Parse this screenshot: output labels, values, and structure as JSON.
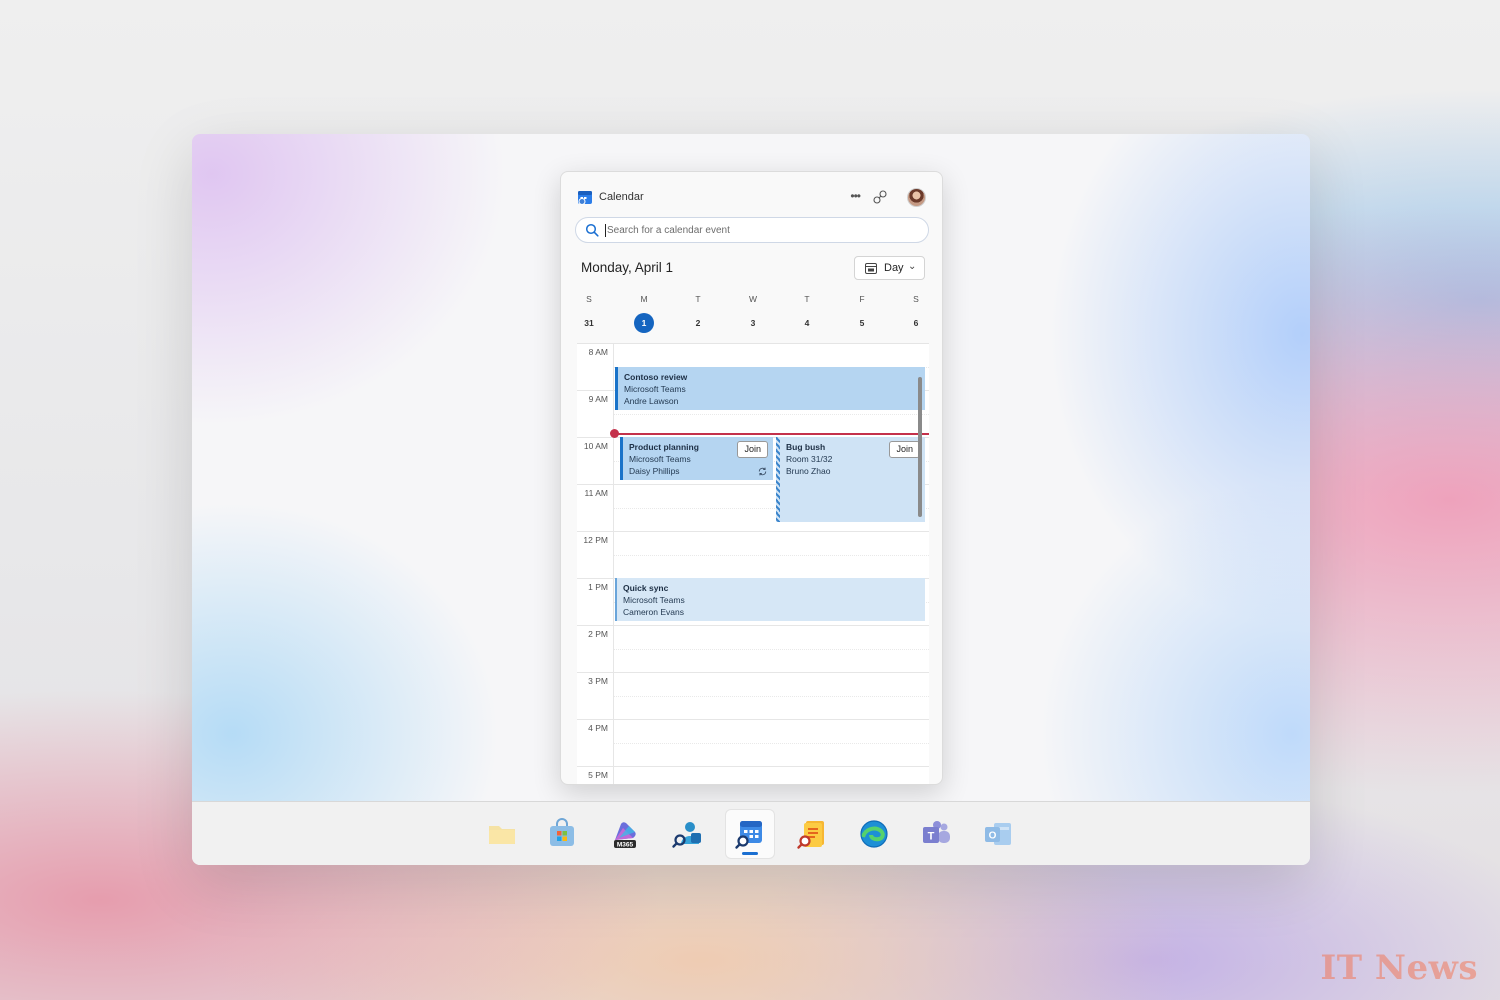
{
  "calendar": {
    "app_title": "Calendar",
    "search_placeholder": "Search for a calendar event",
    "date_title": "Monday, April 1",
    "view_label": "Day",
    "week": [
      {
        "letter": "S",
        "num": "31"
      },
      {
        "letter": "M",
        "num": "1",
        "selected": true
      },
      {
        "letter": "T",
        "num": "2"
      },
      {
        "letter": "W",
        "num": "3"
      },
      {
        "letter": "T",
        "num": "4"
      },
      {
        "letter": "F",
        "num": "5"
      },
      {
        "letter": "S",
        "num": "6"
      }
    ],
    "hours": [
      "8 AM",
      "9 AM",
      "10 AM",
      "11 AM",
      "12 PM",
      "1 PM",
      "2 PM",
      "3 PM",
      "4 PM",
      "5 PM"
    ],
    "events": {
      "contoso": {
        "title": "Contoso review",
        "location": "Microsoft Teams",
        "organizer": "Andre Lawson"
      },
      "product": {
        "title": "Product planning",
        "location": "Microsoft Teams",
        "organizer": "Daisy Phillips",
        "join_label": "Join"
      },
      "bug": {
        "title": "Bug bush",
        "location": "Room 31/32",
        "organizer": "Bruno Zhao",
        "join_label": "Join"
      },
      "quick": {
        "title": "Quick sync",
        "location": "Microsoft Teams",
        "organizer": "Cameron Evans"
      }
    }
  },
  "taskbar": {
    "apps": [
      "file-explorer",
      "microsoft-store",
      "microsoft-365",
      "people",
      "calendar",
      "notes",
      "edge",
      "teams",
      "outlook"
    ],
    "m365_badge": "M365",
    "active": "calendar",
    "accent": "#1a6fd1"
  },
  "watermark": "IT News"
}
